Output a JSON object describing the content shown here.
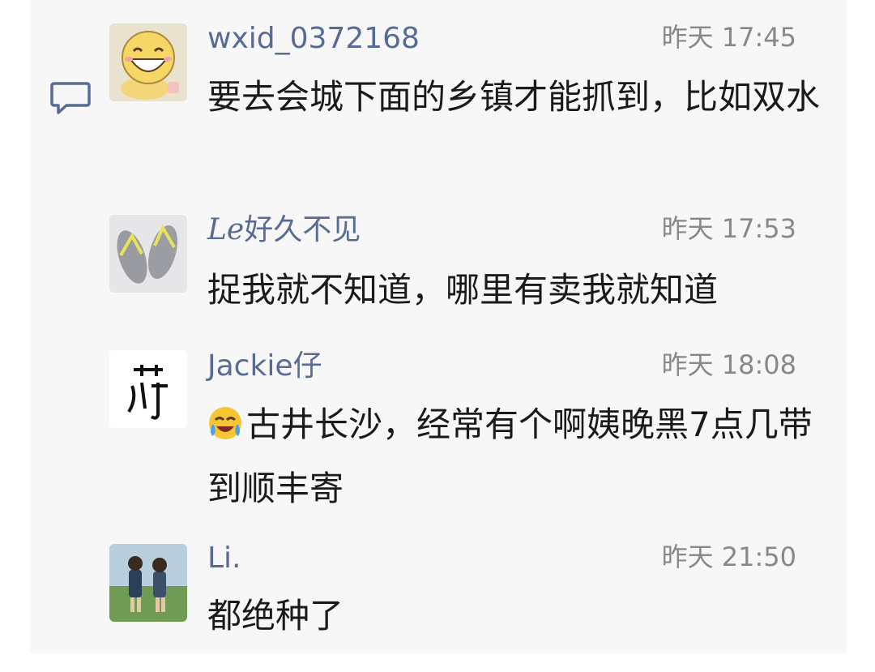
{
  "comments": [
    {
      "name": "wxid_0372168",
      "time": "昨天 17:45",
      "text": "要去会城下面的乡镇才能抓到，比如双水",
      "avatar": "laughing-cartoon-avatar"
    },
    {
      "name": "好久不见",
      "time": "昨天 17:53",
      "text": "捉我就不知道，哪里有卖我就知道",
      "avatar": "slippers-photo-avatar"
    },
    {
      "name": "Jackie仔",
      "time": "昨天 18:08",
      "text": "古井长沙，经常有个啊姨晚黑7点几带到顺丰寄",
      "emoji": "crying-laughing-emoji",
      "avatar": "calligraphy-avatar"
    },
    {
      "name": "Li.",
      "time": "昨天 21:50",
      "text": "都绝种了",
      "avatar": "anime-couple-avatar"
    }
  ],
  "colors": {
    "name": "#576b95",
    "time": "#888888",
    "text": "#1a1a1a",
    "panel": "#f7f7f7"
  },
  "icons": {
    "comment": "comment-bubble-icon"
  }
}
